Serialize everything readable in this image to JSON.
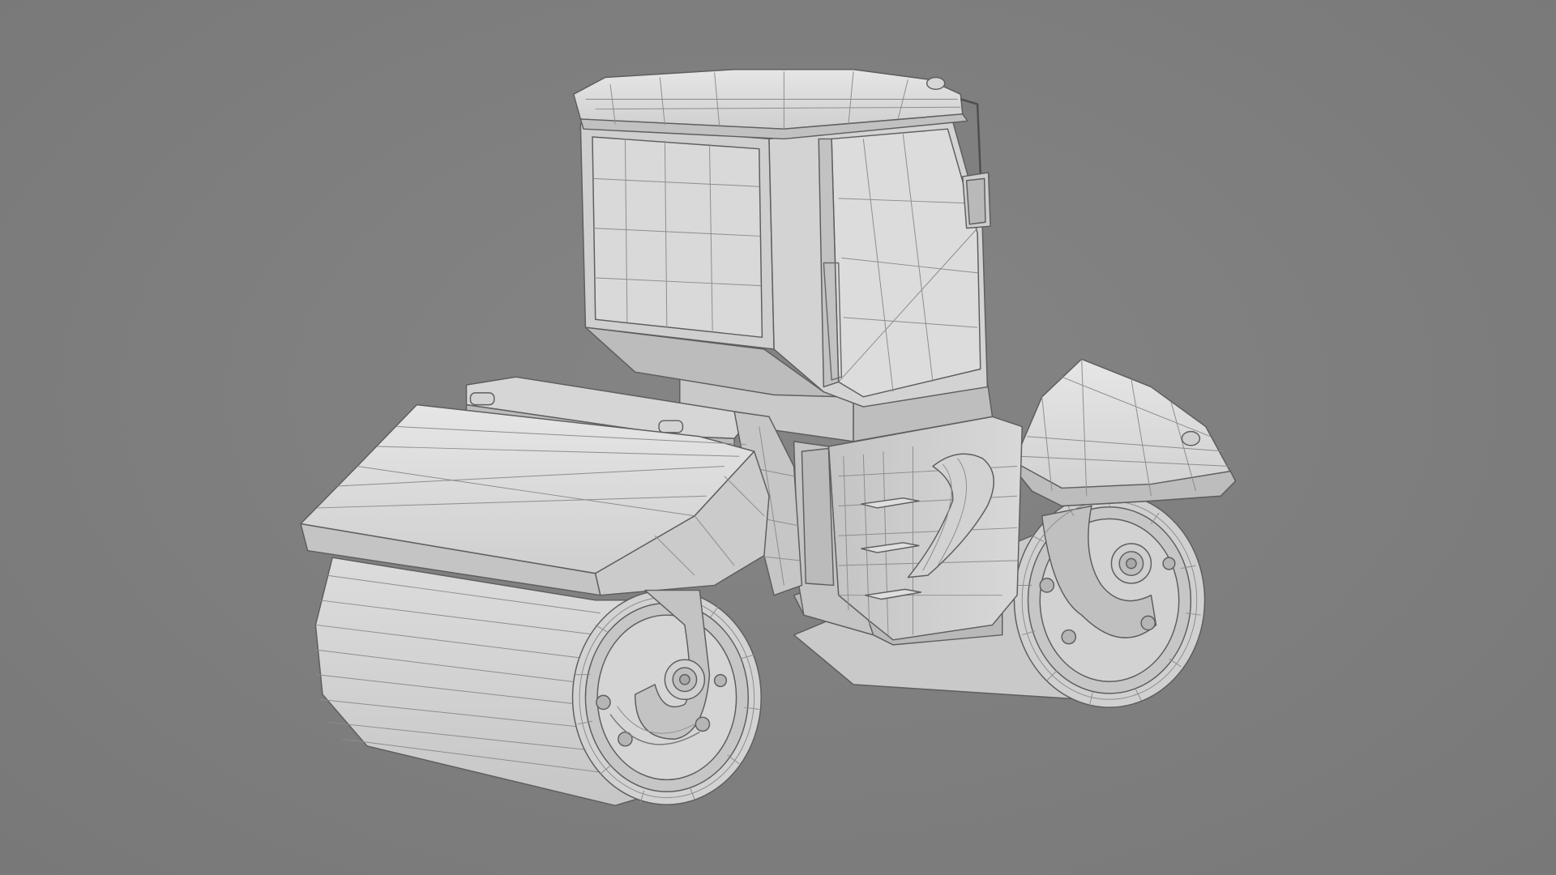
{
  "scene": {
    "subject_icon": "road-roller-wireframe",
    "background_color": "#7e7e7e",
    "body_color": "#cfcfcf",
    "edge_color": "#5a5a5a",
    "wire_color": "#8a8a8a"
  }
}
